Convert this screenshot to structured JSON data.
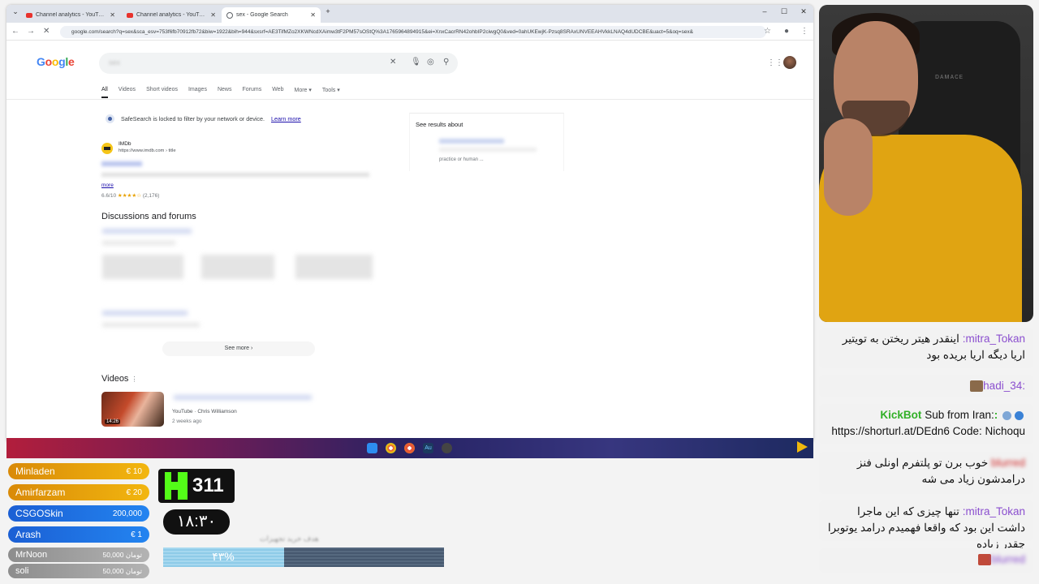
{
  "tabs": [
    {
      "title": "Channel analytics - YouTube Studio",
      "active": false
    },
    {
      "title": "Channel analytics - YouTube Studio",
      "active": false
    },
    {
      "title": "sex - Google Search",
      "active": true
    }
  ],
  "address_url": "google.com/search?q=sex&sca_esv=753f6fb70912fb72&biw=1922&bih=944&sxsrf=AE3TifMZo2XKWNcdXAimw3tF2PM57sOStQ%3A1765964894915&ei=XnxCacrRN42ohbIP2ciwgQ0&ved=0ahUKEwjK-Pzsq8SRAxUNVEEAHVkkLNAQ4dUDCBE&uact=5&oq=sex&",
  "google": {
    "logo": "Google",
    "query": "sex",
    "filters": [
      "All",
      "Videos",
      "Short videos",
      "Images",
      "News",
      "Forums",
      "Web",
      "More ▾",
      "Tools ▾"
    ],
    "safesearch_text": "SafeSearch is locked to filter by your network or device.",
    "safesearch_link": "Learn more",
    "see_results_about": "See results about",
    "see_results_sub": "practice or human ...",
    "imdb_name": "IMDb",
    "imdb_site": "https://www.imdb.com › title",
    "imdb_more": "more",
    "imdb_rating": "6.6/10",
    "imdb_stars": "★★★★☆",
    "imdb_count": "(2,176)",
    "discussions_heading": "Discussions and forums",
    "see_more": "See more",
    "videos_heading": "Videos",
    "video_duration": "14:26",
    "video_meta": "YouTube · Chris Williamson",
    "video_date": "2 weeks ago"
  },
  "chat": [
    {
      "user": "mitra_Tokan:",
      "text": "اینقدر هیتر ریختن به تویتیر اریا دیگه اریا بریده بود",
      "style": "purple"
    },
    {
      "user": ":hadi_34",
      "text": "",
      "style": "purple-emote"
    },
    {
      "user": ":KickBot",
      "text": "Sub from Iran: https://shorturl.at/DEdn6 Code: Nichoqu",
      "style": "green"
    },
    {
      "user": "blurred",
      "text": "خوب برن تو پلتفرم اونلی فنز درامدشون زیاد می شه",
      "style": "red-blur"
    },
    {
      "user": "mitra_Tokan:",
      "text": "تنها چیزی که این ماجرا داشت این بود که واقعا فهمیدم درامد یوتوبرا چقدر زیاده",
      "style": "purple"
    },
    {
      "user": "blurred",
      "text": "",
      "style": "purple-blur"
    }
  ],
  "donations": [
    {
      "name": "Minladen",
      "amount": "€ 10",
      "style": "gold"
    },
    {
      "name": "Amirfarzam",
      "amount": "€ 20",
      "style": "gold"
    },
    {
      "name": "CSGOSkin",
      "amount": "200,000",
      "style": "blue"
    },
    {
      "name": "Arash",
      "amount": "€ 1",
      "style": "blue"
    },
    {
      "name": "MrNoon",
      "amount": "50,000 تومان",
      "style": "grey"
    },
    {
      "name": "soli",
      "amount": "50,000 تومان",
      "style": "grey"
    }
  ],
  "kick_followers": "311",
  "clock": "۱۸:۳۰",
  "goal": {
    "title": "هدف خرید تجهیزات",
    "percent_text": "۴۳%",
    "fraction": 0.43
  },
  "colors": {
    "google_blue": "#4285F4",
    "google_red": "#EA4335",
    "google_yellow": "#FBBC05",
    "google_green": "#34A853",
    "kick_green": "#53FC18"
  }
}
